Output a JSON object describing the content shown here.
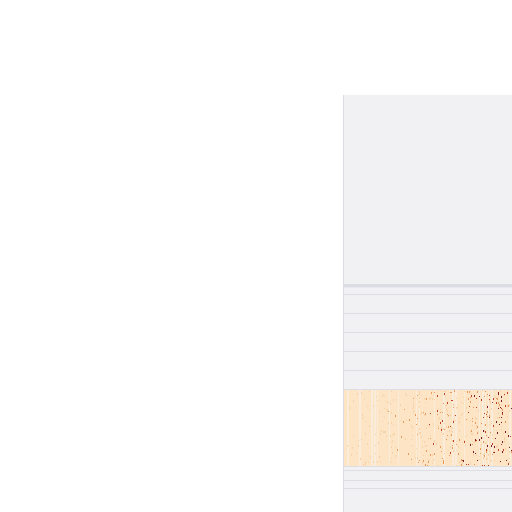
{
  "panel": {
    "tracks": [
      {
        "label": ""
      },
      {
        "label": ""
      },
      {
        "label": ""
      },
      {
        "label": ""
      },
      {
        "label": ""
      },
      {
        "label": ""
      },
      {
        "label": ""
      },
      {
        "label": ""
      },
      {
        "label": ""
      },
      {
        "label": ""
      }
    ]
  },
  "colors": {
    "panel_bg": "#f1f1f4",
    "divider": "#dddde3",
    "heatmap_base": "#fce4c4",
    "heatmap_light": "#f6d2a8",
    "heatmap_mid": "#e89a5c",
    "heatmap_dark": "#c0402a",
    "heatmap_deep": "#7a1c2a"
  }
}
